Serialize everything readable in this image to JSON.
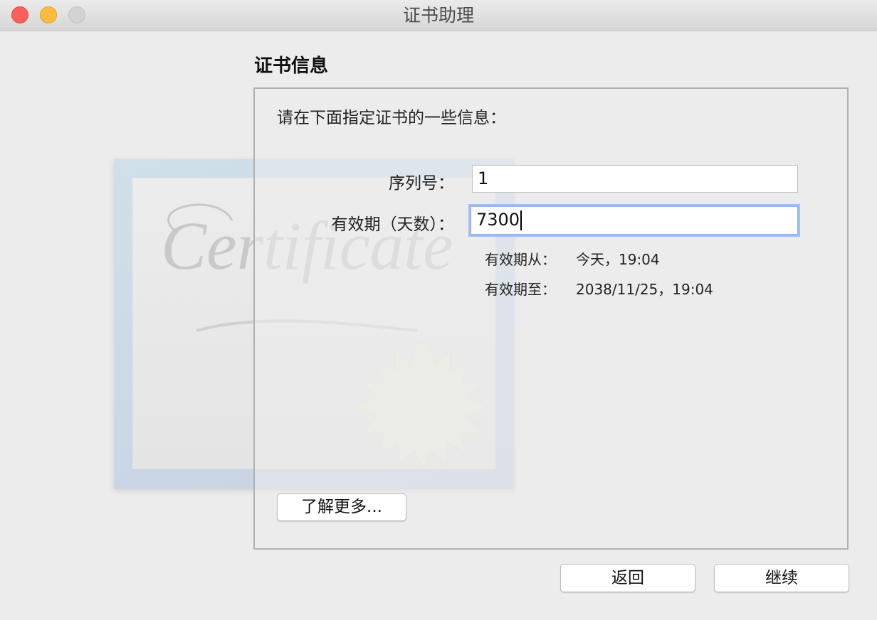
{
  "window": {
    "title": "证书助理"
  },
  "section": {
    "heading": "证书信息",
    "intro": "请在下面指定证书的一些信息："
  },
  "fields": {
    "serial_label": "序列号：",
    "serial_value": "1",
    "validity_label": "有效期（天数）：",
    "validity_value": "7300"
  },
  "validity_info": {
    "from_label": "有效期从：",
    "from_value": "今天，19:04",
    "to_label": "有效期至：",
    "to_value": "2038/11/25，19:04"
  },
  "buttons": {
    "learn_more": "了解更多...",
    "back": "返回",
    "continue": "继续"
  },
  "art": {
    "watermark_text": "Certificate"
  },
  "colors": {
    "close": "#fc605c",
    "minimize": "#fdbc40",
    "zoom": "#d3d3d3",
    "focus_ring": "#9ec0ef"
  }
}
